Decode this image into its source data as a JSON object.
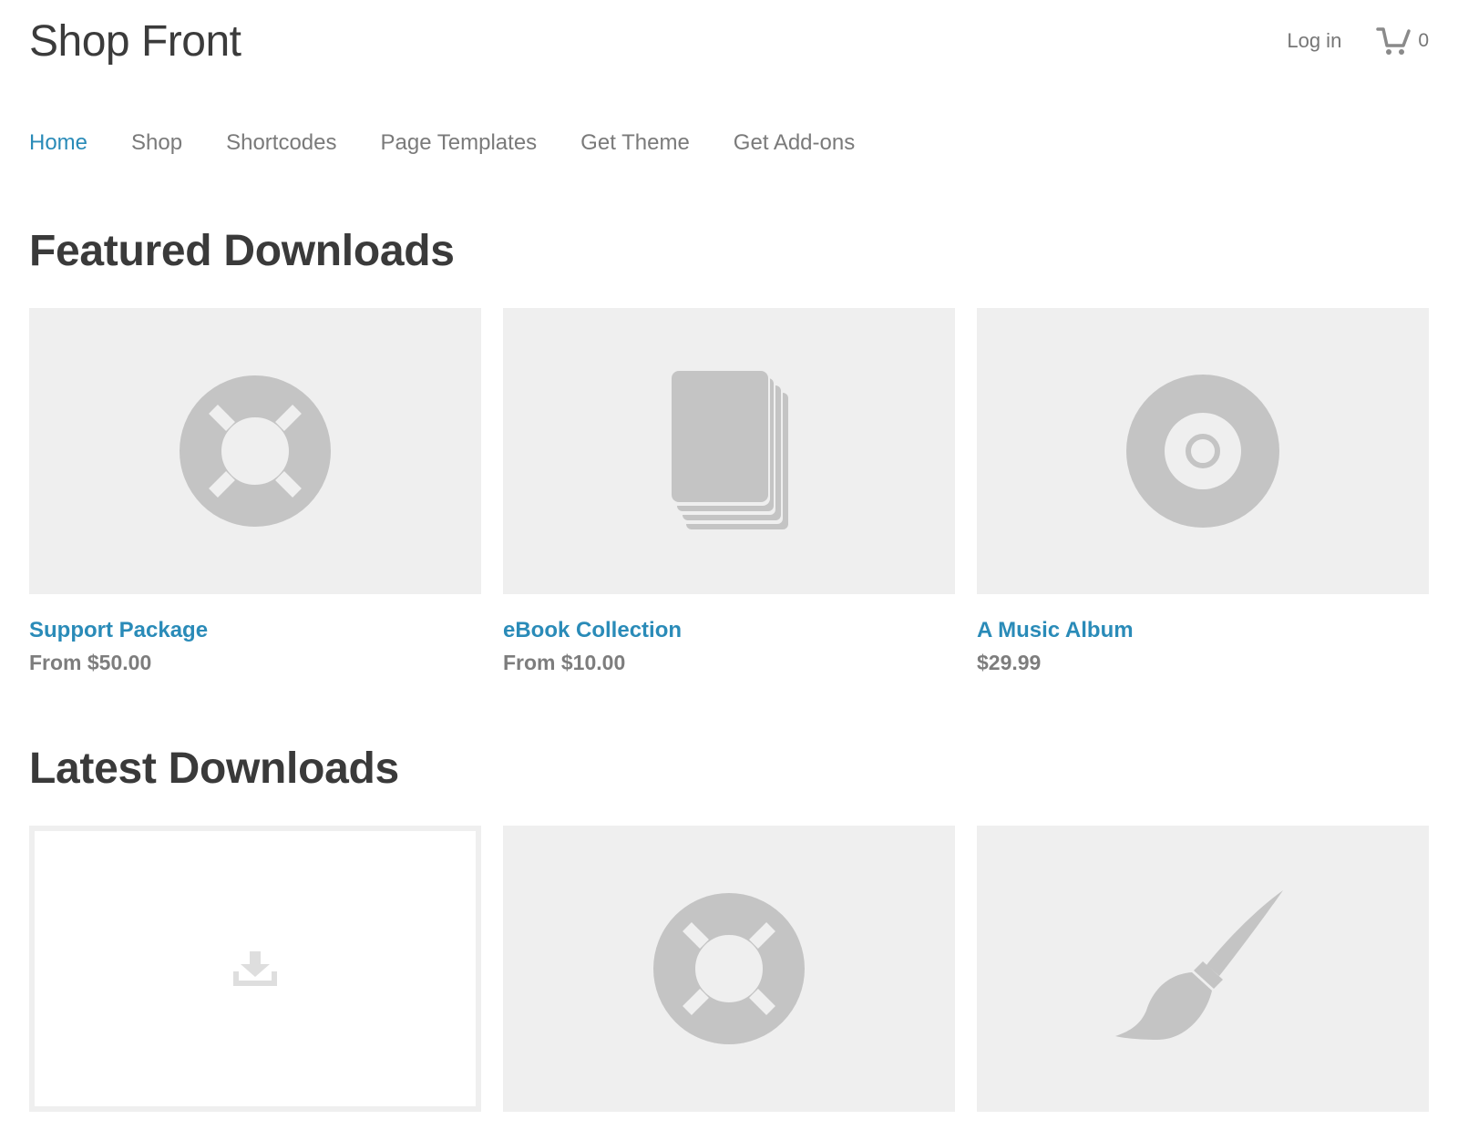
{
  "site": {
    "title": "Shop Front"
  },
  "header": {
    "login_label": "Log in",
    "cart_count": "0"
  },
  "nav": {
    "items": [
      {
        "label": "Home",
        "active": true
      },
      {
        "label": "Shop",
        "active": false
      },
      {
        "label": "Shortcodes",
        "active": false
      },
      {
        "label": "Page Templates",
        "active": false
      },
      {
        "label": "Get Theme",
        "active": false
      },
      {
        "label": "Get Add-ons",
        "active": false
      }
    ]
  },
  "featured": {
    "heading": "Featured Downloads",
    "items": [
      {
        "title": "Support Package",
        "price": "From $50.00",
        "icon": "lifebuoy-icon"
      },
      {
        "title": "eBook Collection",
        "price": "From $10.00",
        "icon": "book-icon"
      },
      {
        "title": "A Music Album",
        "price": "$29.99",
        "icon": "disc-icon"
      }
    ]
  },
  "latest": {
    "heading": "Latest Downloads",
    "items": [
      {
        "icon": "download-icon"
      },
      {
        "icon": "lifebuoy-icon"
      },
      {
        "icon": "paintbrush-icon"
      }
    ]
  },
  "colors": {
    "accent": "#2a8bb8",
    "placeholder_bg": "#efefef",
    "icon_gray": "#c4c4c4"
  }
}
